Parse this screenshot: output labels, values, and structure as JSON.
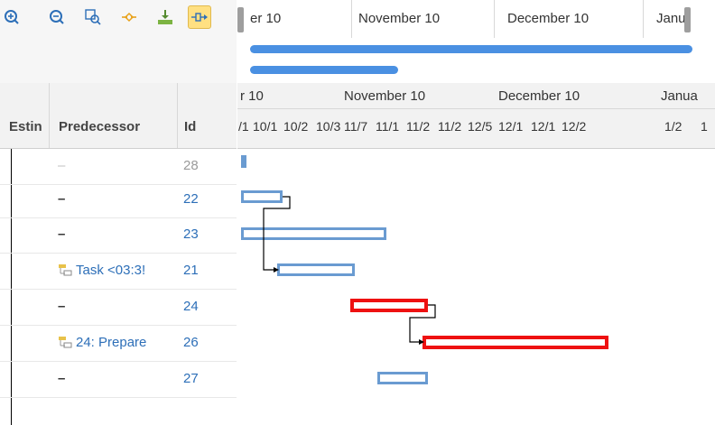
{
  "toolbar": {
    "zoom_in": "⊕",
    "zoom_out": "⊖",
    "zoom_fit": "▣",
    "collapse": "◇",
    "export": "⤓",
    "active_tool": "-▯▸"
  },
  "overview": {
    "months": [
      "er 10",
      "November 10",
      "December 10",
      "Janu"
    ]
  },
  "grid": {
    "headers": {
      "estimate": "Estin",
      "predecessor": "Predecessor",
      "id": "Id"
    },
    "rows": [
      {
        "predecessor": "–",
        "id": "28"
      },
      {
        "predecessor": "–",
        "id": "22"
      },
      {
        "predecessor": "–",
        "id": "23"
      },
      {
        "predecessor": "Task <03:3!",
        "id": "21"
      },
      {
        "predecessor": "–",
        "id": "24"
      },
      {
        "predecessor": "24: Prepare",
        "id": "26"
      },
      {
        "predecessor": "–",
        "id": "27"
      }
    ]
  },
  "scale": {
    "months": [
      "r 10",
      "November 10",
      "December 10",
      "Janua"
    ],
    "days": [
      "/1",
      "10/1",
      "10/2",
      "10/3",
      "11/7",
      "11/1",
      "11/2",
      "11/2",
      "12/5",
      "12/1",
      "12/1",
      "12/2",
      "1/2",
      "1"
    ]
  },
  "colors": {
    "accent": "#4a90e2",
    "bar": "#6a9bd1",
    "critical": "#ee1111",
    "link": "#2d6fb8"
  }
}
